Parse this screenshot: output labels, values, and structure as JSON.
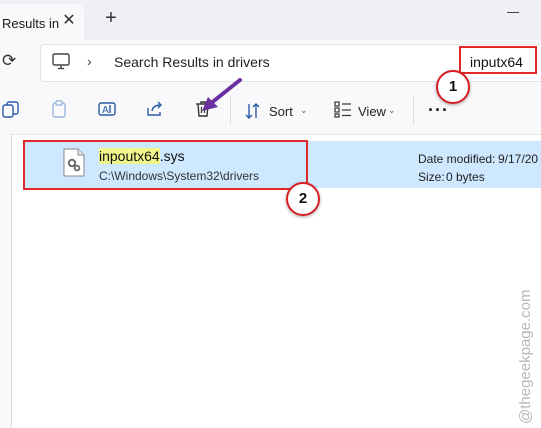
{
  "tab": {
    "title": "Results in",
    "close_glyph": "✕",
    "new_tab_glyph": "+"
  },
  "address": {
    "refresh_glyph": "⟳",
    "location_icon": "pc-icon",
    "separator_glyph": "›",
    "path_text": "Search Results in drivers",
    "search_value": "inputx64"
  },
  "toolbar": {
    "copy_icon": "copy-icon",
    "paste_icon": "paste-icon",
    "rename_icon": "rename-icon",
    "share_icon": "share-icon",
    "delete_icon": "delete-icon",
    "sort_label": "Sort",
    "view_label": "View",
    "caret_glyph": "⌄",
    "more_glyph": "···"
  },
  "file": {
    "name_highlight": "inpoutx64",
    "name_rest": ".sys",
    "path": "C:\\Windows\\System32\\drivers",
    "date_label": "Date modified:",
    "date_value": "9/17/20",
    "size_label": "Size:",
    "size_value": "0 bytes"
  },
  "annotations": {
    "step1": "1",
    "step2": "2",
    "accent_red": "#e02a2a",
    "arrow_color": "#6b2fa0",
    "selection_color": "#cde8ff",
    "highlight_color": "#f2f58b"
  },
  "watermark": "@thegeekpage.com"
}
